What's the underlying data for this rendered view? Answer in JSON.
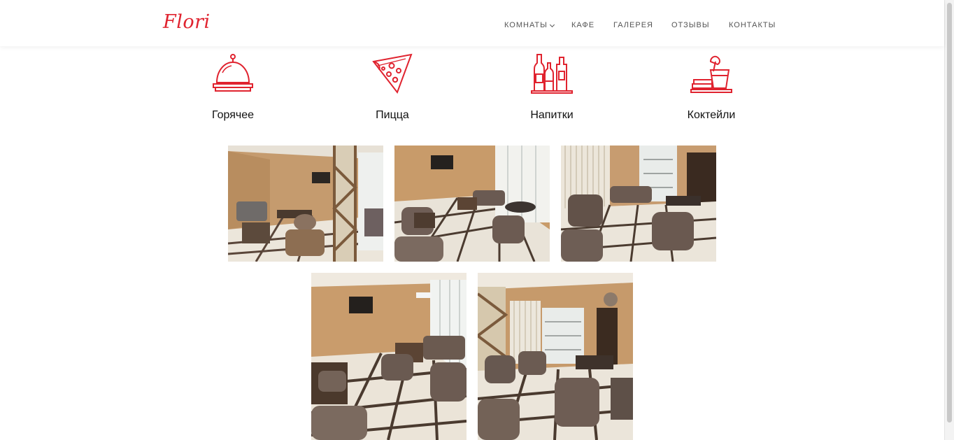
{
  "header": {
    "logo": "Flori",
    "nav": [
      {
        "label": "КОМНАТЫ",
        "has_dropdown": true
      },
      {
        "label": "КАФЕ"
      },
      {
        "label": "ГАЛЕРЕЯ"
      },
      {
        "label": "ОТЗЫВЫ"
      },
      {
        "label": "КОНТАКТЫ"
      }
    ]
  },
  "categories": [
    {
      "label": "Горячее",
      "icon": "cloche-icon"
    },
    {
      "label": "Пицца",
      "icon": "pizza-slice-icon"
    },
    {
      "label": "Напитки",
      "icon": "bottles-icon"
    },
    {
      "label": "Коктейли",
      "icon": "cocktail-icon"
    }
  ],
  "gallery": {
    "photos": [
      {
        "name": "cafe-photo-1"
      },
      {
        "name": "cafe-photo-2"
      },
      {
        "name": "cafe-photo-3"
      },
      {
        "name": "cafe-photo-4"
      },
      {
        "name": "cafe-photo-5"
      }
    ]
  },
  "colors": {
    "accent": "#e0232f",
    "nav_text": "#555555",
    "wall": "#c89b6a",
    "floor": "#e9e3d8",
    "armchair": "#6b5a50"
  }
}
